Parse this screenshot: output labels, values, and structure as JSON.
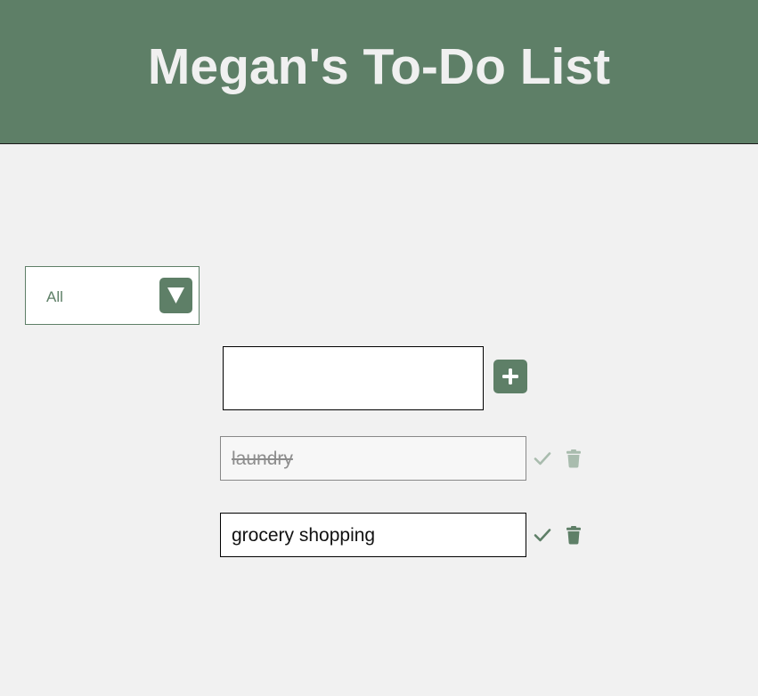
{
  "header": {
    "title": "Megan's To-Do List"
  },
  "filter": {
    "selected": "All"
  },
  "new_todo": {
    "value": "",
    "placeholder": ""
  },
  "todos": [
    {
      "text": "laundry",
      "completed": true
    },
    {
      "text": "grocery shopping",
      "completed": false
    }
  ],
  "icons": {
    "filter_arrow": "triangle-down-icon",
    "add": "plus-icon",
    "complete": "check-icon",
    "delete": "trash-icon"
  },
  "colors": {
    "accent": "#5e7f67",
    "background": "#f1f1f1",
    "title": "#f0f0f0",
    "muted": "#a9bcae"
  }
}
